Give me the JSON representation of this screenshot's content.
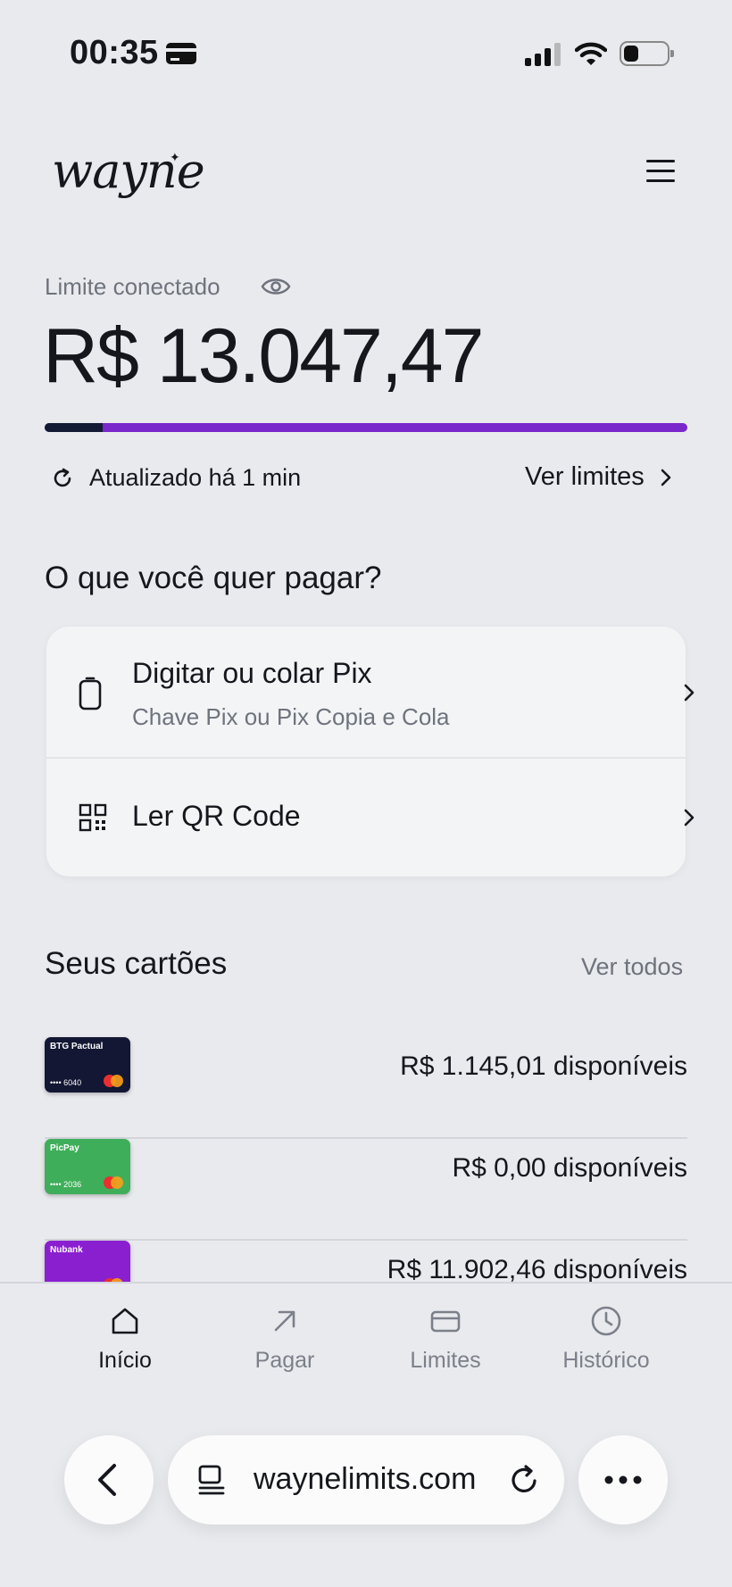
{
  "status_bar": {
    "time": "00:35"
  },
  "header": {
    "logo": "wayne"
  },
  "limit": {
    "label": "Limite conectado",
    "value": "R$ 13.047,47",
    "used_fraction": 0.09,
    "updated": "Atualizado há 1 min",
    "see_limits": "Ver limites"
  },
  "pay": {
    "title": "O que você quer pagar?",
    "options": [
      {
        "title": "Digitar ou colar Pix",
        "subtitle": "Chave Pix ou Pix Copia e Cola",
        "icon": "phone-icon"
      },
      {
        "title": "Ler QR Code",
        "icon": "qr-code-icon"
      }
    ]
  },
  "cards": {
    "title": "Seus cartões",
    "see_all": "Ver todos",
    "items": [
      {
        "name": "BTG Pactual",
        "number": "•••• 6040",
        "available": "R$ 1.145,01 disponíveis",
        "color": "#131733"
      },
      {
        "name": "PicPay",
        "number": "•••• 2036",
        "available": "R$ 0,00 disponíveis",
        "color": "#3fae5a"
      },
      {
        "name": "Nubank",
        "number": "",
        "available": "R$ 11.902,46 disponíveis",
        "color": "#8a1fd0"
      }
    ]
  },
  "nav": {
    "items": [
      {
        "label": "Início",
        "icon": "home-icon",
        "active": true
      },
      {
        "label": "Pagar",
        "icon": "arrow-up-right-icon",
        "active": false
      },
      {
        "label": "Limites",
        "icon": "card-icon",
        "active": false
      },
      {
        "label": "Histórico",
        "icon": "clock-icon",
        "active": false
      }
    ]
  },
  "browser": {
    "url": "waynelimits.com"
  },
  "colors": {
    "accent": "#7a27cc",
    "dark": "#131a33",
    "background": "#e9eaee"
  }
}
